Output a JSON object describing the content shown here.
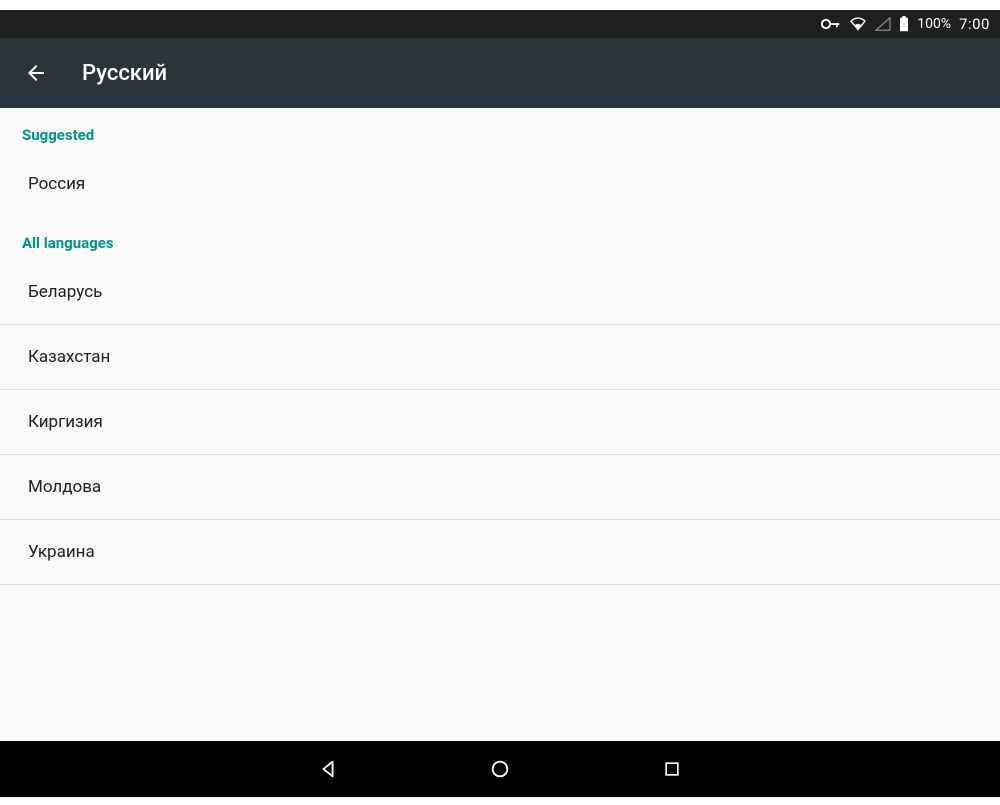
{
  "status": {
    "battery_percent": "100%",
    "time": "7:00"
  },
  "appbar": {
    "title": "Русский"
  },
  "sections": {
    "suggested_header": "Suggested",
    "all_header": "All languages"
  },
  "suggested": [
    {
      "label": "Россия"
    }
  ],
  "all": [
    {
      "label": "Беларусь"
    },
    {
      "label": "Казахстан"
    },
    {
      "label": "Киргизия"
    },
    {
      "label": "Молдова"
    },
    {
      "label": "Украина"
    }
  ]
}
